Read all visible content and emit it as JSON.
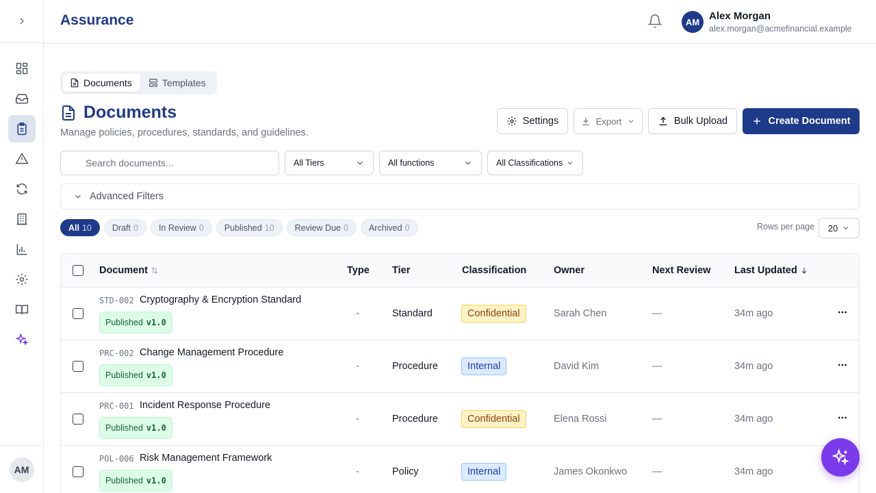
{
  "app": {
    "title": "Assurance"
  },
  "user": {
    "initials": "AM",
    "name": "Alex Morgan",
    "email": "alex.morgan@acmefinancial.example"
  },
  "rail": {
    "items": [
      {
        "icon": "dashboard-icon"
      },
      {
        "icon": "inbox-icon"
      },
      {
        "icon": "clipboard-icon"
      },
      {
        "icon": "alert-triangle-icon"
      },
      {
        "icon": "refresh-icon"
      },
      {
        "icon": "building-icon"
      },
      {
        "icon": "bar-chart-icon"
      },
      {
        "icon": "gear-icon"
      },
      {
        "icon": "book-icon"
      },
      {
        "icon": "sparkles-icon"
      }
    ],
    "avatar_initials": "AM"
  },
  "tabs": [
    {
      "label": "Documents",
      "active": true
    },
    {
      "label": "Templates",
      "active": false
    }
  ],
  "page": {
    "title": "Documents",
    "subtitle": "Manage policies, procedures, standards, and guidelines."
  },
  "actions": {
    "settings": "Settings",
    "export": "Export",
    "bulk_upload": "Bulk Upload",
    "create": "Create Document"
  },
  "filters": {
    "search_placeholder": "Search documents...",
    "tiers": "All Tiers",
    "functions": "All functions",
    "classifications": "All Classifications",
    "advanced": "Advanced Filters"
  },
  "status_chips": [
    {
      "label": "All",
      "count": "10",
      "active": true
    },
    {
      "label": "Draft",
      "count": "0"
    },
    {
      "label": "In Review",
      "count": "0"
    },
    {
      "label": "Published",
      "count": "10"
    },
    {
      "label": "Review Due",
      "count": "0"
    },
    {
      "label": "Archived",
      "count": "0"
    }
  ],
  "pagination": {
    "rows_label": "Rows per page",
    "rows_value": "20"
  },
  "table": {
    "headers": {
      "document": "Document",
      "type": "Type",
      "tier": "Tier",
      "classification": "Classification",
      "owner": "Owner",
      "next_review": "Next Review",
      "last_updated": "Last Updated"
    },
    "rows": [
      {
        "id": "STD-002",
        "title": "Cryptography & Encryption Standard",
        "status": "Published",
        "version": "v1.0",
        "type": "-",
        "tier": "Standard",
        "classification": "Confidential",
        "owner": "Sarah Chen",
        "next_review": "—",
        "updated": "34m ago"
      },
      {
        "id": "PRC-002",
        "title": "Change Management Procedure",
        "status": "Published",
        "version": "v1.0",
        "type": "-",
        "tier": "Procedure",
        "classification": "Internal",
        "owner": "David Kim",
        "next_review": "—",
        "updated": "34m ago"
      },
      {
        "id": "PRC-001",
        "title": "Incident Response Procedure",
        "status": "Published",
        "version": "v1.0",
        "type": "-",
        "tier": "Procedure",
        "classification": "Confidential",
        "owner": "Elena Rossi",
        "next_review": "—",
        "updated": "34m ago"
      },
      {
        "id": "POL-006",
        "title": "Risk Management Framework",
        "status": "Published",
        "version": "v1.0",
        "type": "-",
        "tier": "Policy",
        "classification": "Internal",
        "owner": "James Okonkwo",
        "next_review": "—",
        "updated": "34m ago"
      }
    ]
  },
  "colors": {
    "brand": "#1e3a8a",
    "ai": "#7c3aed"
  }
}
